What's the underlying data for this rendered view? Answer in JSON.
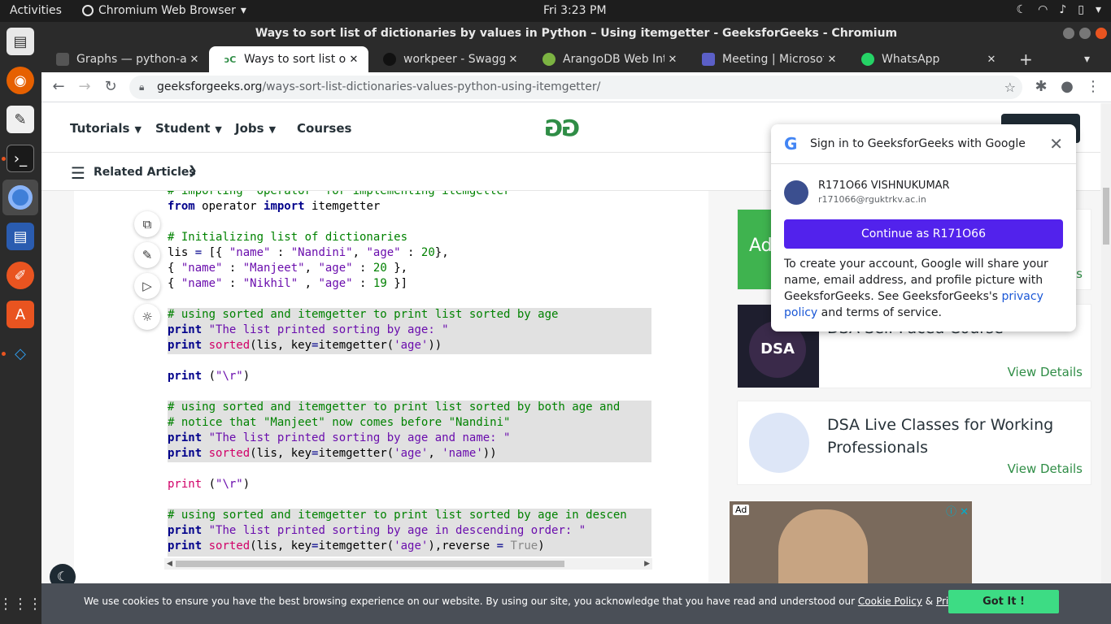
{
  "topbar": {
    "activities": "Activities",
    "app_name": "Chromium Web Browser",
    "clock": "Fri  3:23 PM"
  },
  "window": {
    "title": "Ways to sort list of dictionaries by values in Python – Using itemgetter - GeeksforGeeks - Chromium"
  },
  "tabs": [
    {
      "label": "Graphs — python-a",
      "favicon": "book-icon"
    },
    {
      "label": "Ways to sort list of d",
      "favicon": "gfg-icon"
    },
    {
      "label": "workpeer - Swagge",
      "favicon": "swagger-icon"
    },
    {
      "label": "ArangoDB Web Inte",
      "favicon": "arangodb-icon"
    },
    {
      "label": "Meeting | Microsoft",
      "favicon": "teams-icon"
    },
    {
      "label": "WhatsApp",
      "favicon": "whatsapp-icon"
    }
  ],
  "omnibox": {
    "domain": "geeksforgeeks.org",
    "path": "/ways-sort-list-dictionaries-values-python-using-itemgetter/"
  },
  "nav": {
    "items": [
      "Tutorials",
      "Student",
      "Jobs",
      "Courses"
    ],
    "logo": "GG"
  },
  "related": {
    "label": "Related Articles"
  },
  "code": {
    "line0": "# importing \"operator\" for implementing itemgetter",
    "line1_kw": "from",
    "line1_mid": " operator ",
    "line1_kw2": "import",
    "line1_end": " itemgetter",
    "comment_init": "# Initializing list of dictionaries",
    "comment_age": "# using sorted and itemgetter to print list sorted by age",
    "str_age": "\"The list printed sorting by age: \"",
    "comment_both": "# using sorted and itemgetter to print list sorted by both age and",
    "comment_notice": "# notice that \"Manjeet\" now comes before \"Nandini\"",
    "str_both": "\"The list printed sorting by age and name: \"",
    "comment_desc": "# using sorted and itemgetter to print list sorted by age in descen",
    "str_desc": "\"The list printed sorting by age in descending order: \""
  },
  "cards": [
    {
      "title": "DSA Self Paced Course",
      "detail": "View Details",
      "thumb": "DSA"
    },
    {
      "title_line1": "DSA Live Classes for Working",
      "title_line2": "Professionals",
      "detail": "View Details"
    }
  ],
  "card_partial": {
    "detail": "Details",
    "tag": "Ad"
  },
  "ad": {
    "tag": "Ad",
    "info": "ⓘ ✕"
  },
  "google_popup": {
    "title": "Sign in to GeeksforGeeks with Google",
    "name": "R171O66 VISHNUKUMAR",
    "email": "r171066@rguktrkv.ac.in",
    "continue": "Continue as R171O66",
    "desc_1": "To create your account, Google will share your name, email address, and profile picture with GeeksforGeeks. See GeeksforGeeks's ",
    "link": "privacy policy",
    "desc_2": " and terms of service."
  },
  "cookie": {
    "text": "We use cookies to ensure you have the best browsing experience on our website. By using our site, you acknowledge that you have read and understood our ",
    "link1": "Cookie Policy",
    "amp": " & ",
    "link2": "Privacy Policy",
    "button": "Got It !"
  },
  "colors": {
    "accent_green": "#2f8d46",
    "google_button": "#5222ec",
    "cookie_button": "#3ddc84"
  }
}
